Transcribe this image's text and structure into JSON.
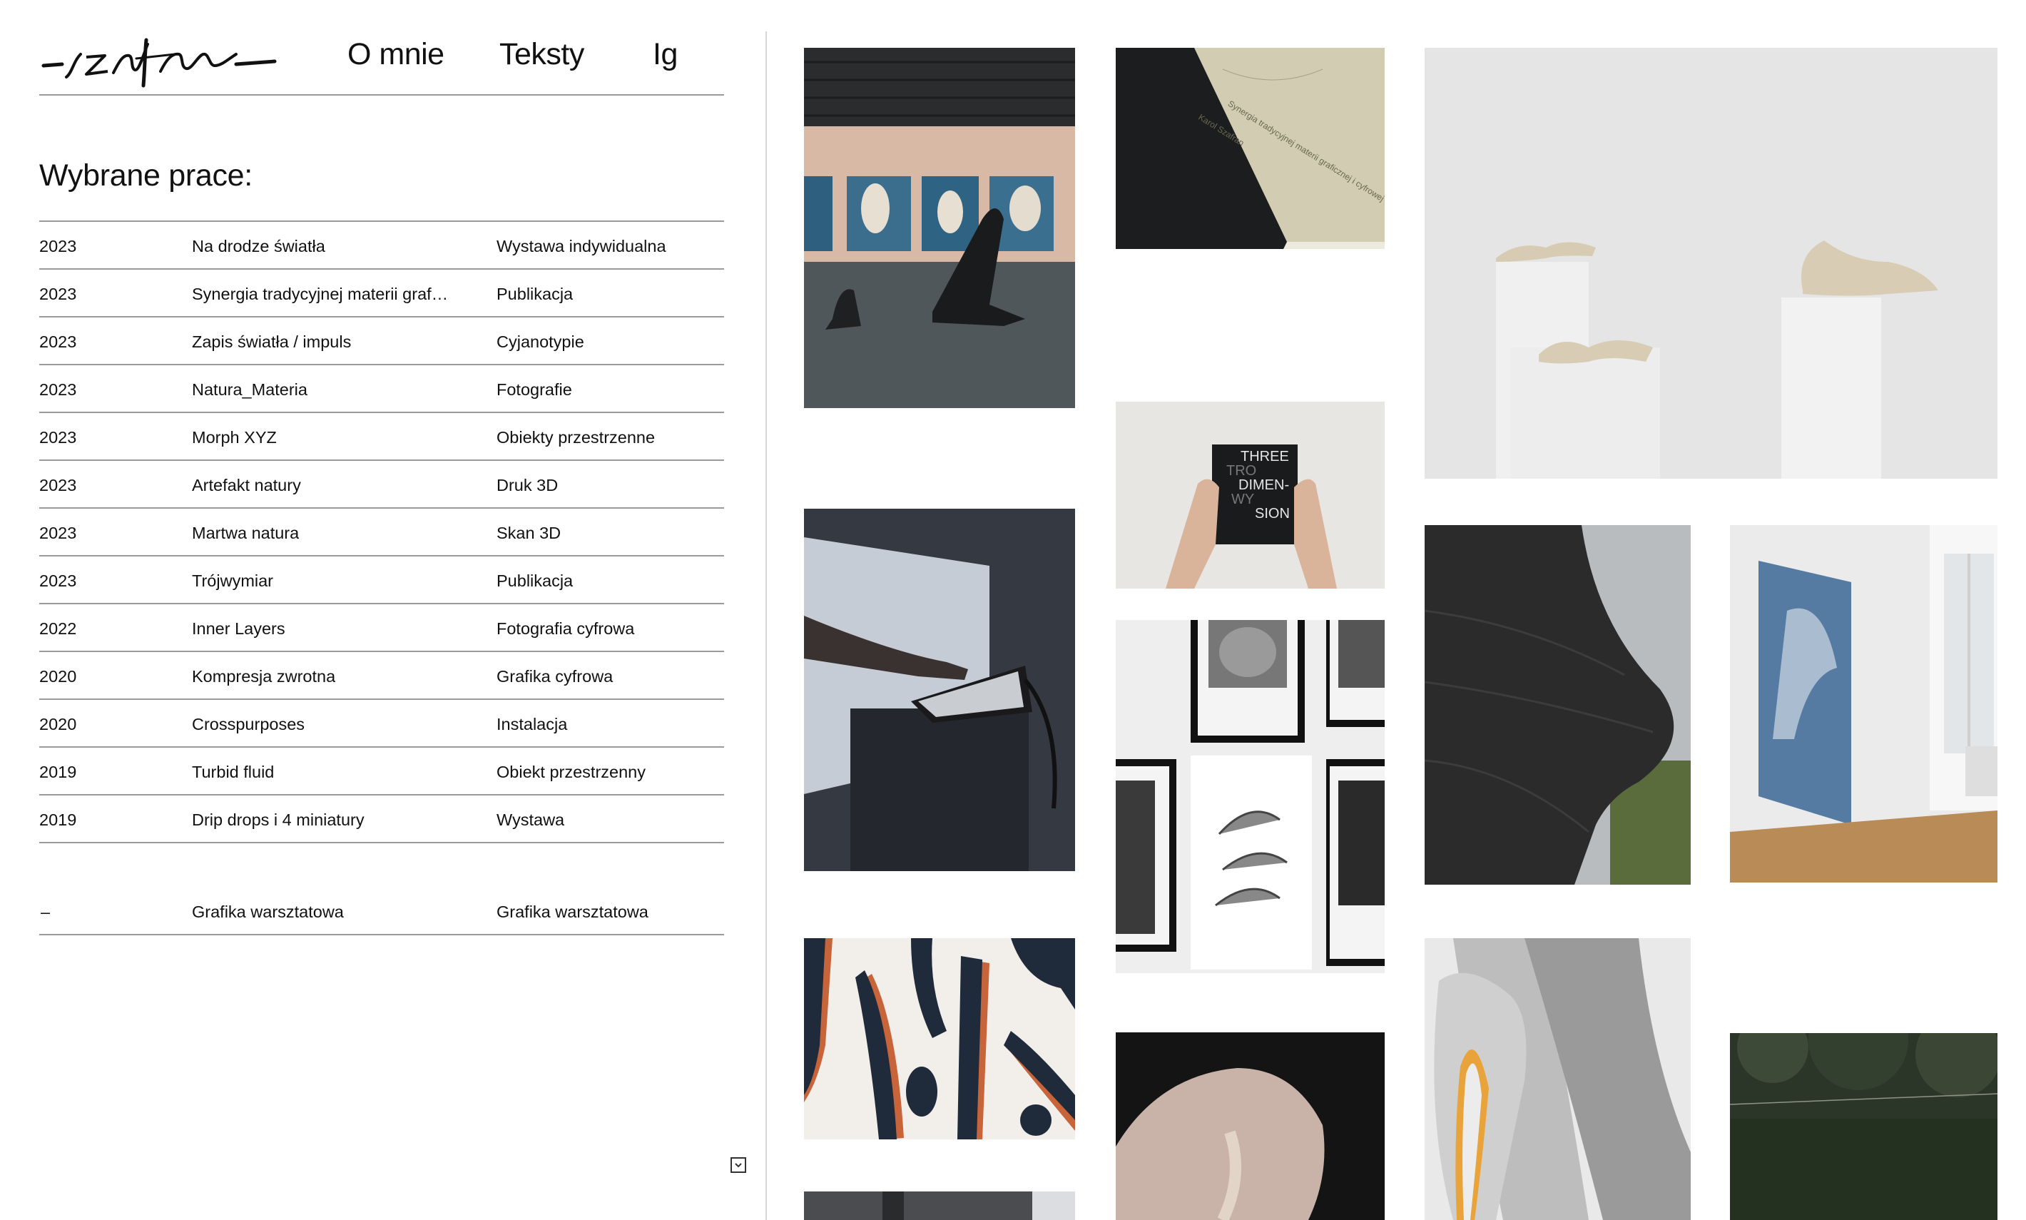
{
  "header": {
    "logo_alt": "Szafran",
    "nav": [
      {
        "label": "O mnie"
      },
      {
        "label": "Teksty"
      },
      {
        "label": "Ig"
      }
    ]
  },
  "section_title": "Wybrane prace:",
  "works": [
    {
      "year": "2023",
      "title": "Na drodze światła",
      "category": "Wystawa indywidualna"
    },
    {
      "year": "2023",
      "title": "Synergia tradycyjnej materii grafi...",
      "category": "Publikacja"
    },
    {
      "year": "2023",
      "title": "Zapis światła / impuls",
      "category": "Cyjanotypie"
    },
    {
      "year": "2023",
      "title": "Natura_Materia",
      "category": "Fotografie"
    },
    {
      "year": "2023",
      "title": "Morph XYZ",
      "category": "Obiekty przestrzenne"
    },
    {
      "year": "2023",
      "title": "Artefakt natury",
      "category": "Druk 3D"
    },
    {
      "year": "2023",
      "title": "Martwa natura",
      "category": "Skan 3D"
    },
    {
      "year": "2023",
      "title": "Trójwymiar",
      "category": "Publikacja"
    },
    {
      "year": "2022",
      "title": "Inner Layers",
      "category": "Fotografia cyfrowa"
    },
    {
      "year": "2020",
      "title": "Kompresja zwrotna",
      "category": "Grafika cyfrowa"
    },
    {
      "year": "2020",
      "title": "Crosspurposes",
      "category": "Instalacja"
    },
    {
      "year": "2019",
      "title": "Turbid fluid",
      "category": "Obiekt przestrzenny"
    },
    {
      "year": "2019",
      "title": "Drip drops i 4 miniatury",
      "category": "Wystawa"
    }
  ],
  "extra_work": {
    "year": "–",
    "title": "Grafika warsztatowa",
    "category": "Grafika warsztatowa"
  },
  "gallery": {
    "book_title": "Synergia tradycyjnej materii graficznej i cyfrowej",
    "book_author": "Karol Szafran",
    "book2_lines": [
      "THREE",
      "TRO",
      "DIMEN-",
      "WY",
      "SION"
    ]
  },
  "icons": {
    "scroll": "chevron-down-icon"
  }
}
